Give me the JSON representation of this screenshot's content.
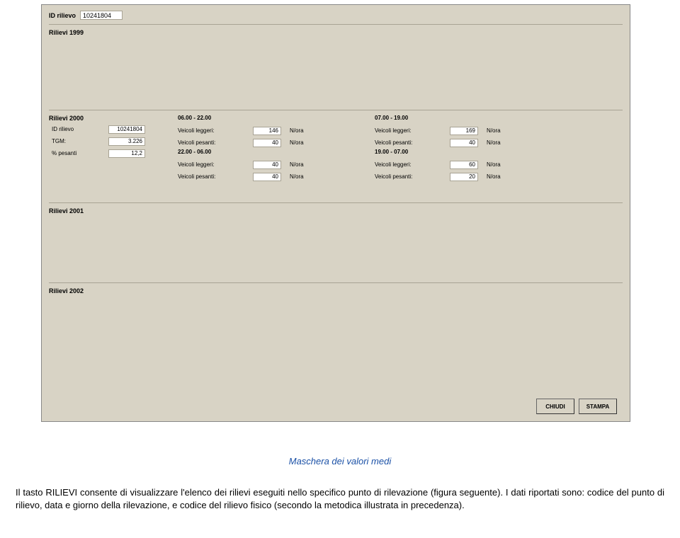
{
  "header": {
    "id_rilievo_label": "ID rilievo",
    "id_rilievo_value": "10241804"
  },
  "sections": {
    "y1999": "Rilievi 1999",
    "y2000": "Rilievi 2000",
    "y2001": "Rilievi 2001",
    "y2002": "Rilievi 2002"
  },
  "left": {
    "id_label": "ID rilievo",
    "id_value": "10241804",
    "tgm_label": "TGM:",
    "tgm_value": "3.226",
    "pct_label": "% pesanti",
    "pct_value": "12,2"
  },
  "col_a": {
    "t1": "06.00 - 22.00",
    "r1_lab": "Veicoli leggeri:",
    "r1_val": "146",
    "r1_unit": "N/ora",
    "r2_lab": "Veicoli pesanti:",
    "r2_val": "40",
    "r2_unit": "N/ora",
    "t2": "22.00 - 06.00",
    "r3_lab": "Veicoli leggeri:",
    "r3_val": "40",
    "r3_unit": "N/ora",
    "r4_lab": "Veicoli pesanti:",
    "r4_val": "40",
    "r4_unit": "N/ora"
  },
  "col_b": {
    "t1": "07.00 - 19.00",
    "r1_lab": "Veicoli leggeri:",
    "r1_val": "169",
    "r1_unit": "N/ora",
    "r2_lab": "Veicoli pesanti:",
    "r2_val": "40",
    "r2_unit": "N/ora",
    "t2": "19.00 - 07.00",
    "r3_lab": "Veicoli leggeri:",
    "r3_val": "60",
    "r3_unit": "N/ora",
    "r4_lab": "Veicoli pesanti:",
    "r4_val": "20",
    "r4_unit": "N/ora"
  },
  "buttons": {
    "chiudi": "CHIUDI",
    "stampa": "STAMPA"
  },
  "caption": "Maschera dei valori medi",
  "para": "Il tasto RILIEVI consente di visualizzare l'elenco dei rilievi eseguiti nello specifico punto di rilevazione (figura seguente). I dati riportati sono: codice del punto di rilievo, data e giorno della rilevazione, e codice del rilievo fisico (secondo la metodica illustrata in precedenza)."
}
